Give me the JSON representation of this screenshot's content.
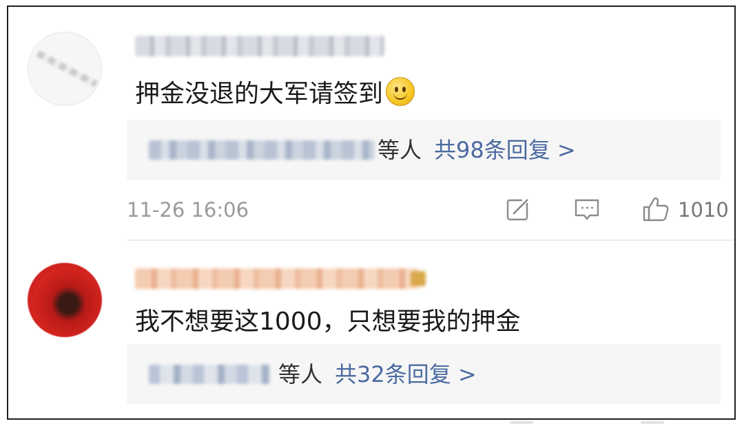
{
  "comments": [
    {
      "text": "押金没退的大军请签到",
      "emoji": "smiley-emoji",
      "reply_others": "等人",
      "reply_count": "共98条回复 >",
      "timestamp": "11-26 16:06",
      "like_count": "1010",
      "icons": [
        "share-icon",
        "comment-icon",
        "thumbs-up-icon"
      ]
    },
    {
      "text": "我不想要这1000，只想要我的押金",
      "reply_others": "等人",
      "reply_count": "共32条回复 >"
    }
  ],
  "colors": {
    "reply_link": "#4a6aa0",
    "reply_bg": "#f6f6f6",
    "meta_text": "#9a9a9a",
    "avatar_red": "#d4241f"
  }
}
